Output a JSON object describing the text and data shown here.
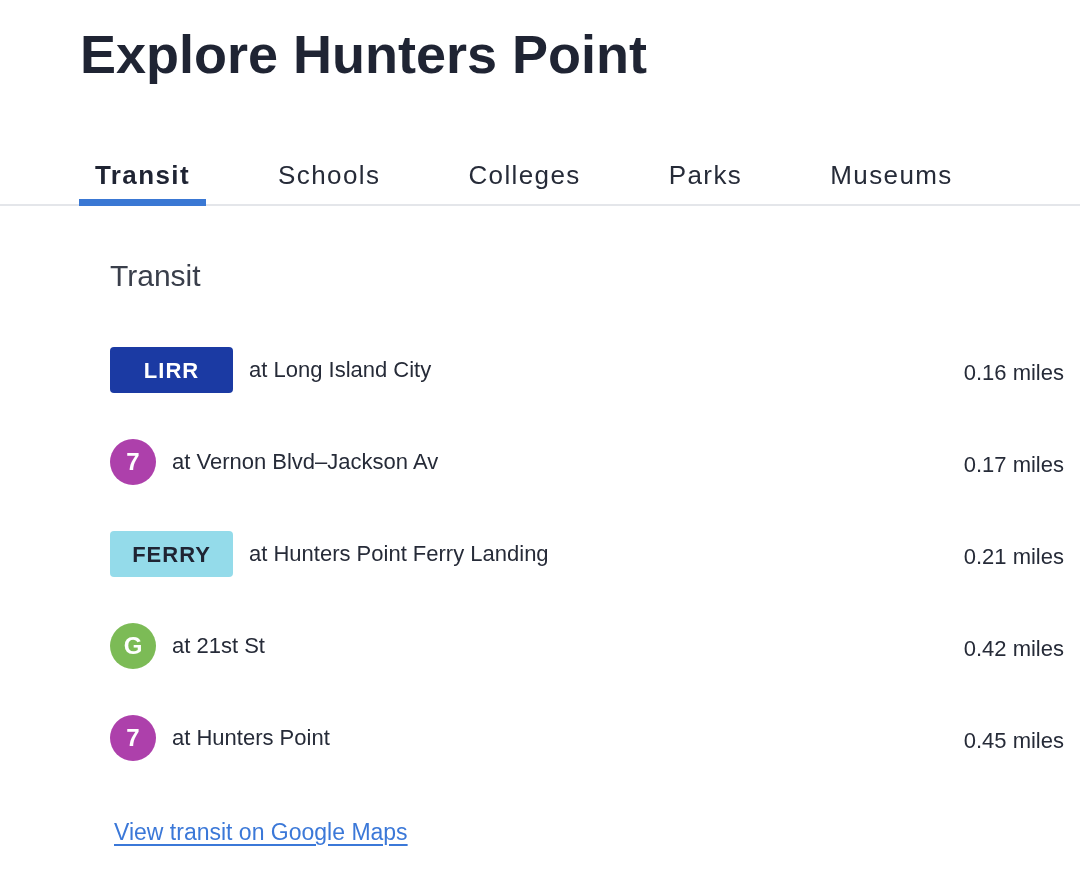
{
  "title": "Explore Hunters Point",
  "tabs": [
    {
      "label": "Transit",
      "selected": true
    },
    {
      "label": "Schools",
      "selected": false
    },
    {
      "label": "Colleges",
      "selected": false
    },
    {
      "label": "Parks",
      "selected": false
    },
    {
      "label": "Museums",
      "selected": false
    }
  ],
  "section": {
    "heading": "Transit",
    "items": [
      {
        "kind": "badge",
        "line": "LIRR",
        "color": "#1b3aa3",
        "stop": "at Long Island City",
        "distance": "0.16 miles"
      },
      {
        "kind": "bullet",
        "line": "7",
        "color": "#ad40ab",
        "stop": "at Vernon Blvd–Jackson Av",
        "distance": "0.17 miles"
      },
      {
        "kind": "badge",
        "line": "FERRY",
        "color": "#94dbea",
        "stop": "at Hunters Point Ferry Landing",
        "distance": "0.21 miles"
      },
      {
        "kind": "bullet",
        "line": "G",
        "color": "#7cbb56",
        "stop": "at 21st St",
        "distance": "0.42 miles"
      },
      {
        "kind": "bullet",
        "line": "7",
        "color": "#ad40ab",
        "stop": "at Hunters Point",
        "distance": "0.45 miles"
      }
    ]
  },
  "link": "View transit on Google Maps"
}
